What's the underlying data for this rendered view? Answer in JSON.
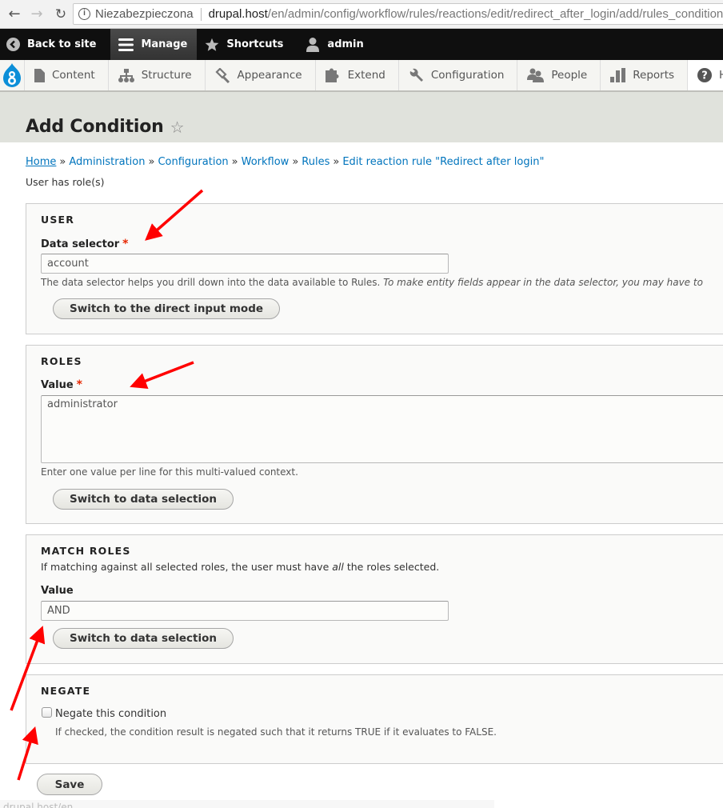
{
  "browser": {
    "security_label": "Niezabezpieczona",
    "url_host": "drupal.host",
    "url_path": "/en/admin/config/workflow/rules/reactions/edit/redirect_after_login/add/rules_condition",
    "back_icon": "arrow-left-icon",
    "forward_icon": "arrow-right-icon",
    "reload_icon": "reload-icon"
  },
  "toolbar": {
    "back_to_site": "Back to site",
    "manage": "Manage",
    "shortcuts": "Shortcuts",
    "user": "admin"
  },
  "tray": {
    "items": [
      {
        "label": "Content",
        "icon": "file-icon"
      },
      {
        "label": "Structure",
        "icon": "sitemap-icon"
      },
      {
        "label": "Appearance",
        "icon": "paintbrush-icon"
      },
      {
        "label": "Extend",
        "icon": "puzzle-icon"
      },
      {
        "label": "Configuration",
        "icon": "wrench-icon"
      },
      {
        "label": "People",
        "icon": "people-icon"
      },
      {
        "label": "Reports",
        "icon": "bar-chart-icon"
      },
      {
        "label": "Help",
        "icon": "question-icon"
      }
    ]
  },
  "page": {
    "title": "Add Condition",
    "breadcrumb": [
      "Home",
      "Administration",
      "Configuration",
      "Workflow",
      "Rules",
      "Edit reaction rule \"Redirect after login\""
    ],
    "breadcrumb_separator": "»",
    "condition_name": "User has role(s)"
  },
  "form": {
    "user": {
      "legend": "USER",
      "label": "Data selector",
      "required_mark": "*",
      "value": "account",
      "description": "The data selector helps you drill down into the data available to Rules.",
      "description_italic": "To make entity fields appear in the data selector, you may have to",
      "button": "Switch to the direct input mode"
    },
    "roles": {
      "legend": "ROLES",
      "label": "Value",
      "required_mark": "*",
      "value": "administrator",
      "description": "Enter one value per line for this multi-valued context.",
      "button": "Switch to data selection"
    },
    "match_roles": {
      "legend": "MATCH ROLES",
      "description_before": "If matching against all selected roles, the user must have",
      "description_italic": "all",
      "description_after": "the roles selected.",
      "label": "Value",
      "value": "AND",
      "button": "Switch to data selection"
    },
    "negate": {
      "legend": "NEGATE",
      "checkbox_label": "Negate this condition",
      "checked": false,
      "description": "If checked, the condition result is negated such that it returns TRUE if it evaluates to FALSE."
    },
    "save": "Save"
  },
  "status_bar": "drupal.host/en",
  "colors": {
    "link": "#0074bd",
    "required": "#e62600",
    "annotation_arrow": "#ff0000",
    "toolbar_bg": "#0f0f0f",
    "header_bg": "#e0e2dc"
  }
}
